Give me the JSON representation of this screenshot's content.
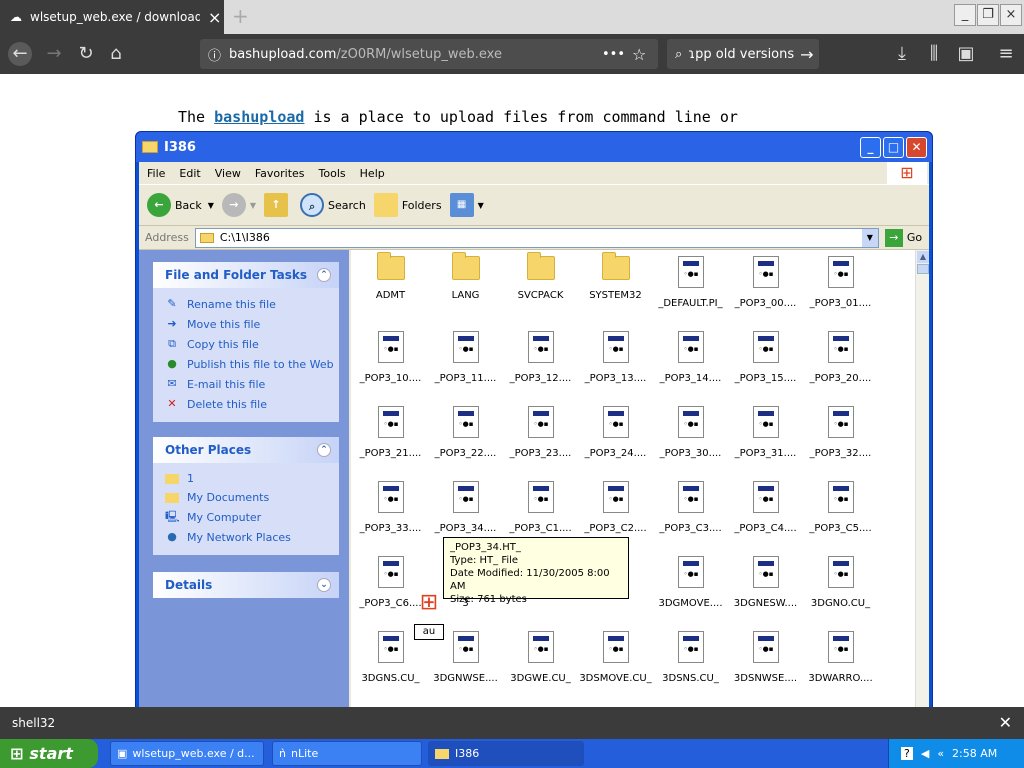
{
  "browser": {
    "tab_title": "wlsetup_web.exe / download fror",
    "url_domain": "bashupload.com",
    "url_path": "/zO0RM/wlsetup_web.exe",
    "search_text": "ɿpp old versions"
  },
  "webpage": {
    "text_before": "The ",
    "link_text": "bashupload",
    "text_after": " is a place to upload files from command line or"
  },
  "explorer": {
    "title": "I386",
    "menu": [
      "File",
      "Edit",
      "View",
      "Favorites",
      "Tools",
      "Help"
    ],
    "toolbar": {
      "back": "Back",
      "search": "Search",
      "folders": "Folders"
    },
    "address_label": "Address",
    "address_value": "C:\\1\\I386",
    "go_label": "Go",
    "file_tasks": {
      "title": "File and Folder Tasks",
      "items": [
        "Rename this file",
        "Move this file",
        "Copy this file",
        "Publish this file to the Web",
        "E-mail this file",
        "Delete this file"
      ]
    },
    "other_places": {
      "title": "Other Places",
      "items": [
        "1",
        "My Documents",
        "My Computer",
        "My Network Places"
      ]
    },
    "details": {
      "title": "Details"
    },
    "files": [
      [
        "ADMT",
        "LANG",
        "SVCPACK",
        "SYSTEM32",
        "_DEFAULT.PI_",
        "_POP3_00....",
        "_POP3_01...."
      ],
      [
        "_POP3_10....",
        "_POP3_11....",
        "_POP3_12....",
        "_POP3_13....",
        "_POP3_14....",
        "_POP3_15....",
        "_POP3_20...."
      ],
      [
        "_POP3_21....",
        "_POP3_22....",
        "_POP3_23....",
        "_POP3_24....",
        "_POP3_30....",
        "_POP3_31....",
        "_POP3_32...."
      ],
      [
        "_POP3_33....",
        "_POP3_34....",
        "_POP3_C1....",
        "_POP3_C2....",
        "_POP3_C3....",
        "_POP3_C4....",
        "_POP3_C5...."
      ],
      [
        "_POP3_C6....",
        "3",
        "",
        "",
        "3DGMOVE....",
        "3DGNESW....",
        "3DGNO.CU_"
      ],
      [
        "3DGNS.CU_",
        "3DGNWSE....",
        "3DGWE.CU_",
        "3DSMOVE.CU_",
        "3DSNS.CU_",
        "3DSNWSE....",
        "3DWARRO...."
      ]
    ],
    "tooltip": {
      "name": "_POP3_34.HT_",
      "type": "Type: HT_ File",
      "date": "Date Modified: 11/30/2005 8:00 AM",
      "size": "Size: 761 bytes"
    },
    "drag_label": "au"
  },
  "download_bar": {
    "label": "shell32"
  },
  "taskbar": {
    "start": "start",
    "items": [
      "wlsetup_web.exe / d...",
      "nLite",
      "I386"
    ],
    "clock": "2:58 AM"
  }
}
